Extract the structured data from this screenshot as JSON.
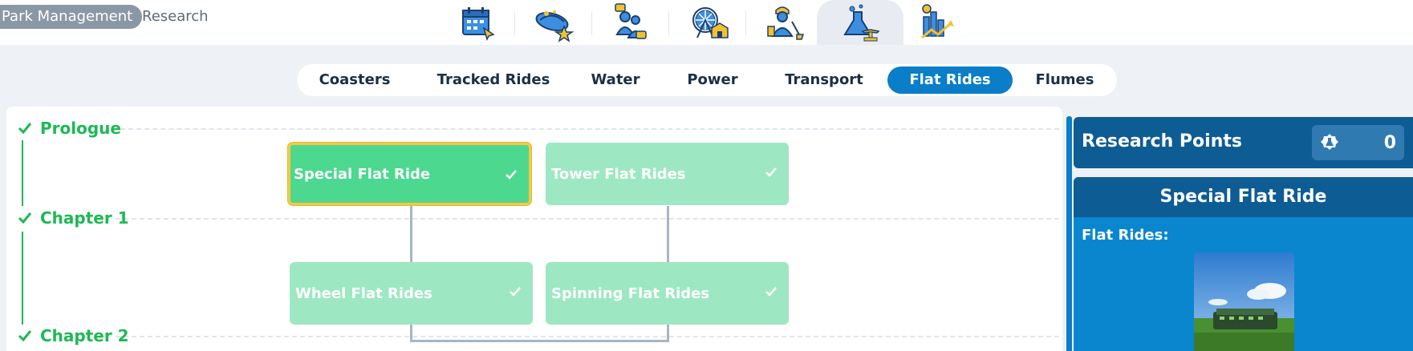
{
  "breadcrumb": {
    "parent": "Park Management",
    "current": "Research"
  },
  "category_tabs": [
    {
      "name": "calendar-icon"
    },
    {
      "name": "ride-star-icon"
    },
    {
      "name": "guests-icon"
    },
    {
      "name": "ferris-wheel-shop-icon"
    },
    {
      "name": "staff-icon"
    },
    {
      "name": "research-flask-icon",
      "active": true
    },
    {
      "name": "finance-chart-icon"
    }
  ],
  "subtabs": {
    "items": [
      "Coasters",
      "Tracked Rides",
      "Water",
      "Power",
      "Transport",
      "Flat Rides",
      "Flumes"
    ],
    "selected": "Flat Rides"
  },
  "tree": {
    "chapters": [
      "Prologue",
      "Chapter 1",
      "Chapter 2"
    ],
    "nodes": [
      {
        "label": "Special Flat Ride",
        "completed": true,
        "selected": true
      },
      {
        "label": "Tower Flat Rides",
        "completed": true
      },
      {
        "label": "Wheel Flat Rides",
        "completed": true
      },
      {
        "label": "Spinning Flat Rides",
        "completed": true
      }
    ]
  },
  "research_points": {
    "title": "Research Points",
    "value": "0"
  },
  "detail": {
    "title": "Special Flat Ride",
    "category_label": "Flat Rides:"
  },
  "colors": {
    "accent": "#0a7ec8",
    "complete_green": "#1db955",
    "node_selected": "#4cd88f",
    "node_unlocked": "#9de8c2",
    "panel_dark": "#0e5c94"
  }
}
